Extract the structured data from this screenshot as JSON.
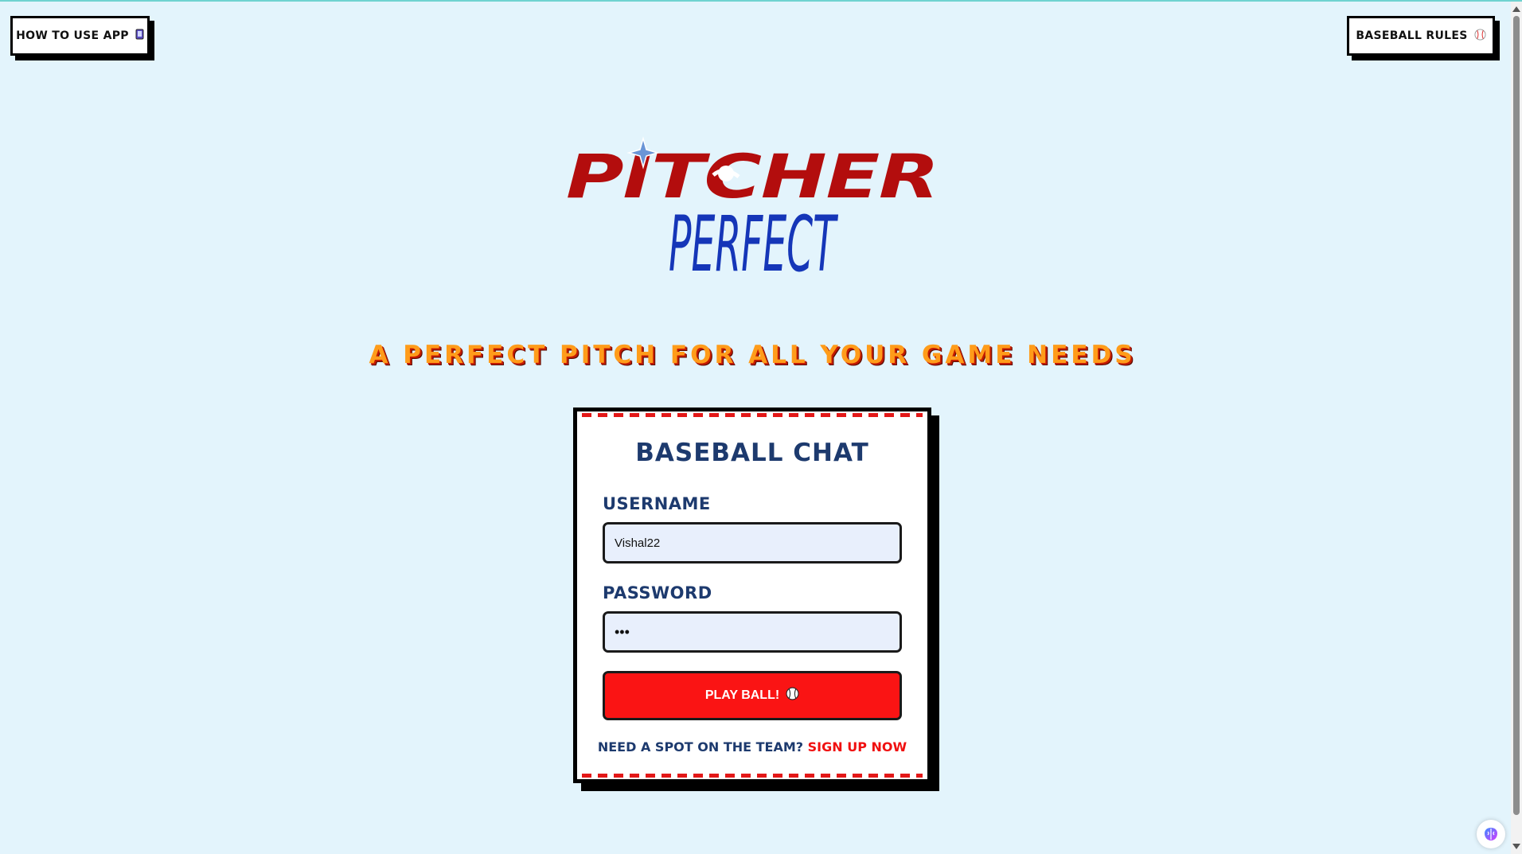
{
  "header": {
    "how_to_label": "HOW TO USE APP",
    "how_to_icon": "phone-icon",
    "rules_label": "BASEBALL RULES",
    "rules_icon": "baseball-icon"
  },
  "logo": {
    "line1": "PITCHER",
    "line2": "PERFECT",
    "colors": {
      "line1": "#b30d0d",
      "line2": "#1536b8",
      "spark": "#6a95d6"
    }
  },
  "tagline": "A PERFECT PITCH FOR ALL YOUR GAME NEEDS",
  "login": {
    "title": "BASEBALL CHAT",
    "username_label": "USERNAME",
    "username_value": "Vishal22",
    "password_label": "PASSWORD",
    "password_value": "•••",
    "submit_label": "PLAY BALL!",
    "submit_icon": "baseball-icon",
    "signup_prompt": "NEED A SPOT ON THE TEAM?",
    "signup_link": "SIGN UP NOW"
  },
  "colors": {
    "background": "#e3f4fc",
    "accent_red": "#fa1414",
    "navy": "#1d3a6e",
    "tagline_orange": "#ff9c1a"
  },
  "extension_icon": "brain-icon"
}
